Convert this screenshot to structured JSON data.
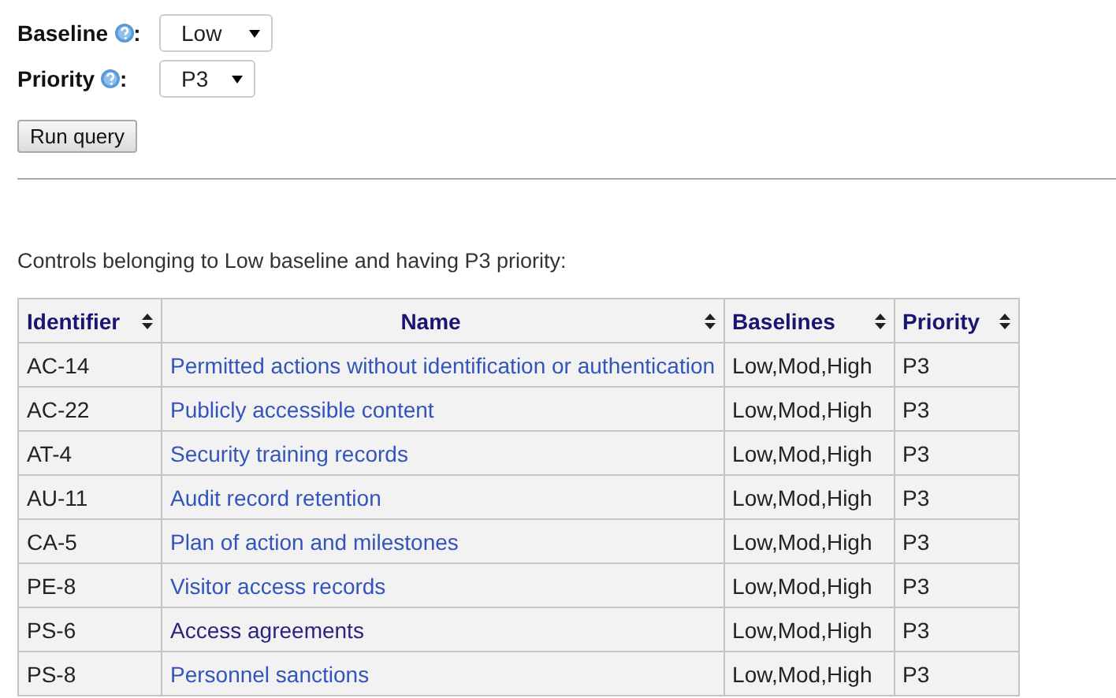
{
  "filters": [
    {
      "label": "Baseline",
      "suffix": ":",
      "value": "Low"
    },
    {
      "label": "Priority",
      "suffix": ":",
      "value": "P3"
    }
  ],
  "run_button": "Run query",
  "caption": "Controls belonging to Low baseline and having P3 priority:",
  "table": {
    "columns": [
      "Identifier",
      "Name",
      "Baselines",
      "Priority"
    ],
    "rows": [
      {
        "identifier": "AC-14",
        "name": "Permitted actions without identification or authentication",
        "visited": false,
        "baselines": "Low,Mod,High",
        "priority": "P3"
      },
      {
        "identifier": "AC-22",
        "name": "Publicly accessible content",
        "visited": false,
        "baselines": "Low,Mod,High",
        "priority": "P3"
      },
      {
        "identifier": "AT-4",
        "name": "Security training records",
        "visited": false,
        "baselines": "Low,Mod,High",
        "priority": "P3"
      },
      {
        "identifier": "AU-11",
        "name": "Audit record retention",
        "visited": false,
        "baselines": "Low,Mod,High",
        "priority": "P3"
      },
      {
        "identifier": "CA-5",
        "name": "Plan of action and milestones",
        "visited": false,
        "baselines": "Low,Mod,High",
        "priority": "P3"
      },
      {
        "identifier": "PE-8",
        "name": "Visitor access records",
        "visited": false,
        "baselines": "Low,Mod,High",
        "priority": "P3"
      },
      {
        "identifier": "PS-6",
        "name": "Access agreements",
        "visited": true,
        "baselines": "Low,Mod,High",
        "priority": "P3"
      },
      {
        "identifier": "PS-8",
        "name": "Personnel sanctions",
        "visited": false,
        "baselines": "Low,Mod,High",
        "priority": "P3"
      }
    ]
  }
}
